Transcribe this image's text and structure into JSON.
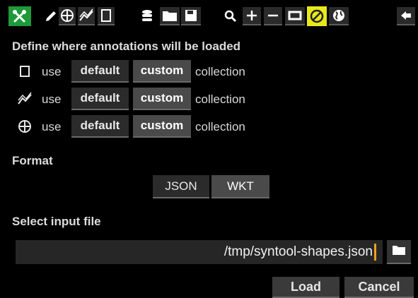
{
  "toolbar": {
    "icons": [
      "tools-icon",
      "pencil-icon",
      "point-icon",
      "polyline-icon",
      "polygon-icon",
      "database-icon",
      "folder-icon",
      "save-icon",
      "search-icon",
      "zoom-in-icon",
      "zoom-out-icon",
      "swap-icon",
      "disable-icon",
      "globe-icon",
      "back-icon"
    ],
    "active_color": "#1f9a3a",
    "highlight_color": "#e8e81e"
  },
  "annotations_section": {
    "title": "Define where annotations will be loaded",
    "rows": [
      {
        "icon": "polygon-icon",
        "use_label": "use",
        "default_label": "default",
        "custom_label": "custom",
        "suffix": "collection",
        "selected": "custom"
      },
      {
        "icon": "polyline-icon",
        "use_label": "use",
        "default_label": "default",
        "custom_label": "custom",
        "suffix": "collection",
        "selected": "custom"
      },
      {
        "icon": "point-icon",
        "use_label": "use",
        "default_label": "default",
        "custom_label": "custom",
        "suffix": "collection",
        "selected": "custom"
      }
    ]
  },
  "format_section": {
    "title": "Format",
    "options": [
      "JSON",
      "WKT"
    ],
    "selected": "WKT"
  },
  "input_section": {
    "title": "Select input file",
    "file_value": "/tmp/syntool-shapes.json"
  },
  "actions": {
    "load_label": "Load",
    "cancel_label": "Cancel"
  }
}
